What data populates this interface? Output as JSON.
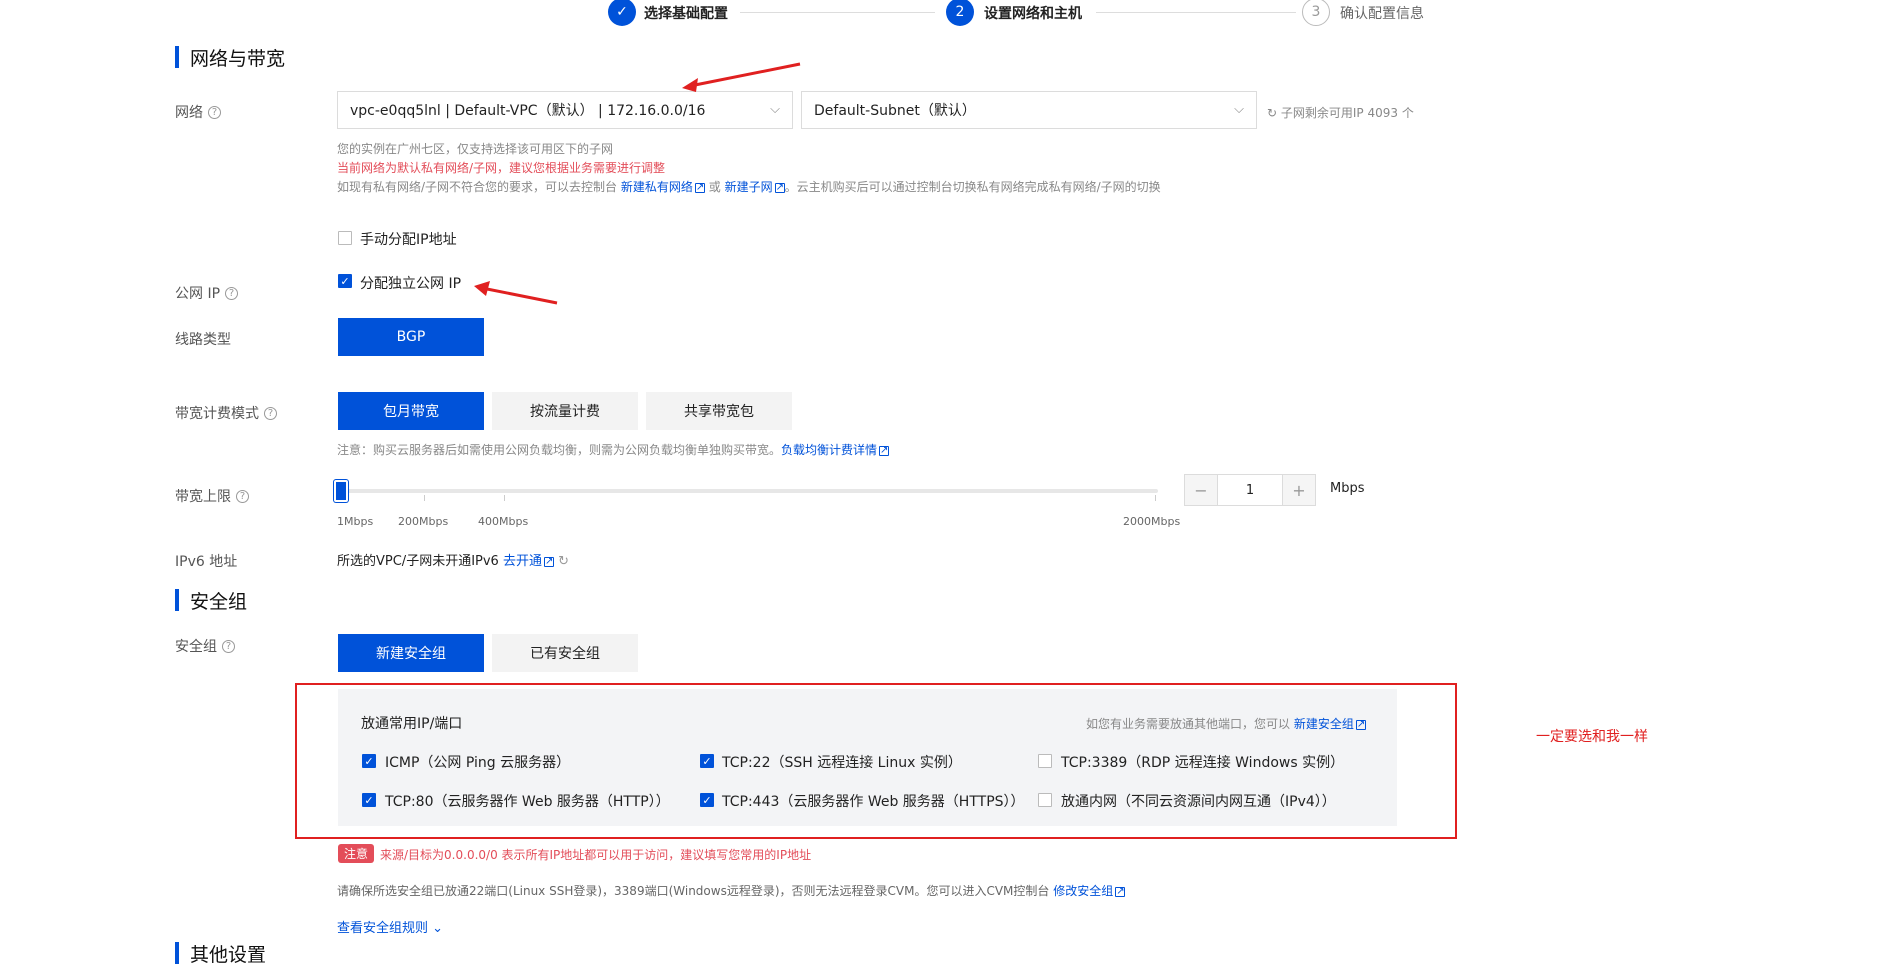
{
  "stepper": {
    "steps": [
      {
        "num": "✓",
        "label": "选择基础配置",
        "state": "done"
      },
      {
        "num": "2",
        "label": "设置网络和主机",
        "state": "active"
      },
      {
        "num": "3",
        "label": "确认配置信息",
        "state": "pending"
      }
    ]
  },
  "network_section": {
    "title": "网络与带宽",
    "network_label": "网络",
    "vpc_value": "vpc-e0qq5lnl | Default-VPC（默认） | 172.16.0.0/16",
    "subnet_value": "Default-Subnet（默认）",
    "refresh_text": "子网剩余可用IP 4093 个",
    "note_1": "您的实例在广州七区，仅支持选择该可用区下的子网",
    "note_2": "当前网络为默认私有网络/子网，建议您根据业务需要进行调整",
    "note_3_prefix": "如现有私有网络/子网不符合您的要求，可以去控制台",
    "note_3_link1": "新建私有网络",
    "note_3_or": "或",
    "note_3_link2": "新建子网",
    "note_3_suffix": "。云主机购买后可以通过控制台切换私有网络完成私有网络/子网的切换",
    "manual_ip_label": "手动分配IP地址",
    "manual_ip_checked": false
  },
  "public_ip": {
    "label": "公网 IP",
    "checkbox_label": "分配独立公网 IP",
    "checked": true
  },
  "line_type": {
    "label": "线路类型",
    "option": "BGP"
  },
  "billing": {
    "label": "带宽计费模式",
    "options": [
      "包月带宽",
      "按流量计费",
      "共享带宽包"
    ],
    "selected": "包月带宽",
    "note_prefix": "注意：购买云服务器后如需使用公网负载均衡，则需为公网负载均衡单独购买带宽。",
    "note_link": "负载均衡计费详情"
  },
  "bandwidth": {
    "label": "带宽上限",
    "ticks": [
      "1Mbps",
      "200Mbps",
      "400Mbps",
      "2000Mbps"
    ],
    "value": "1",
    "unit": "Mbps",
    "minus": "−",
    "plus": "+"
  },
  "ipv6": {
    "label": "IPv6 地址",
    "text": "所选的VPC/子网未开通IPv6",
    "link": "去开通"
  },
  "security_section": {
    "title": "安全组",
    "label": "安全组",
    "options": [
      "新建安全组",
      "已有安全组"
    ],
    "selected": "新建安全组",
    "panel_title": "放通常用IP/端口",
    "panel_hint_prefix": "如您有业务需要放通其他端口，您可以",
    "panel_hint_link": "新建安全组",
    "ports": [
      {
        "label": "ICMP（公网 Ping 云服务器）",
        "checked": true
      },
      {
        "label": "TCP:22（SSH 远程连接 Linux 实例）",
        "checked": true
      },
      {
        "label": "TCP:3389（RDP 远程连接 Windows 实例）",
        "checked": false
      },
      {
        "label": "TCP:80（云服务器作 Web 服务器（HTTP））",
        "checked": true
      },
      {
        "label": "TCP:443（云服务器作 Web 服务器（HTTPS））",
        "checked": true
      },
      {
        "label": "放通内网（不同云资源间内网互通（IPv4））",
        "checked": false
      }
    ],
    "annotation": "一定要选和我一样",
    "warn_badge": "注意",
    "warn_text": "来源/目标为0.0.0.0/0 表示所有IP地址都可以用于访问，建议填写您常用的IP地址",
    "info_prefix": "请确保所选安全组已放通22端口(Linux SSH登录)，3389端口(Windows远程登录)，否则无法远程登录CVM。您可以进入CVM控制台",
    "info_link": "修改安全组",
    "rules_link": "查看安全组规则"
  },
  "other_section": {
    "title": "其他设置"
  }
}
